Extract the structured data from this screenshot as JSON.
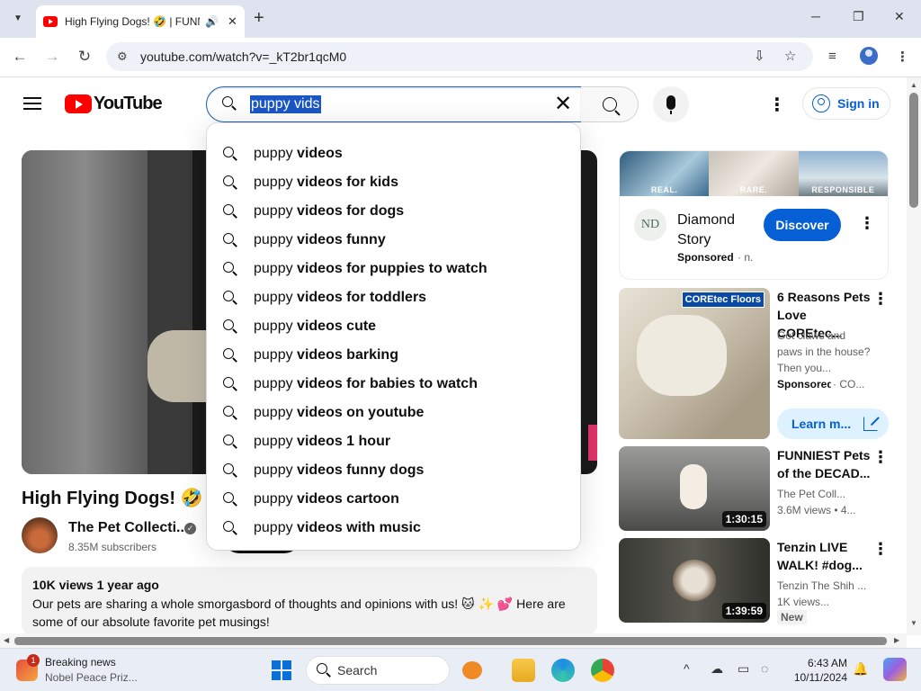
{
  "browser": {
    "tab_title": "High Flying Dogs! 🤣 | FUNNY Pet Videos",
    "url": "youtube.com/watch?v=_kT2br1qcM0"
  },
  "header": {
    "logo_text": "YouTube",
    "search_query": "puppy vids",
    "search_placeholder": "Search",
    "signin_label": "Sign in"
  },
  "suggestions": {
    "typed_prefix": "puppy ",
    "items": [
      "videos",
      "videos for kids",
      "videos for dogs",
      "videos funny",
      "videos for puppies to watch",
      "videos for toddlers",
      "videos cute",
      "videos barking",
      "videos for babies to watch",
      "videos on youtube",
      "videos 1 hour",
      "videos funny dogs",
      "videos cartoon",
      "videos with music"
    ]
  },
  "video": {
    "title": "High Flying Dogs! 🤣 |",
    "channel_name": "The Pet Collecti...",
    "subscribers": "8.35M subscribers",
    "views_age": "10K views  1 year ago",
    "description": "Our pets are sharing a whole smorgasbord of thoughts and opinions with us! 🐱 ✨ 💕 Here are some of our absolute favorite pet musings!"
  },
  "ad": {
    "banner_labels": [
      "REAL.",
      "RARE.",
      "RESPONSIBLE"
    ],
    "logo_text": "ND",
    "name": "Diamond Story",
    "sponsored": "Sponsored",
    "domain": "· n.",
    "cta": "Discover"
  },
  "recommendations": [
    {
      "title": "6 Reasons Pets Love COREtec...",
      "description": "Got claws and paws in the house? Then you...",
      "sponsored": "Sponsored",
      "advertiser": "· CO...",
      "cta": "Learn m...",
      "logo": "COREtec Floors"
    },
    {
      "title": "FUNNIEST Pets of the DECAD...",
      "channel": "The Pet Coll...",
      "stats": "3.6M views  • 4...",
      "duration": "1:30:15"
    },
    {
      "title": "Tenzin LIVE WALK! #dog...",
      "channel": "Tenzin The Shih ...",
      "stats": "1K views...",
      "badge": "New",
      "duration": "1:39:59"
    }
  ],
  "taskbar": {
    "news_title": "Breaking news",
    "news_sub": "Nobel Peace Priz...",
    "news_badge": "1",
    "search_label": "Search",
    "time": "6:43 AM",
    "date": "10/11/2024"
  },
  "colors": {
    "youtube_red": "#ff0000",
    "link_blue": "#065fd4",
    "search_border": "#1c62b9"
  }
}
